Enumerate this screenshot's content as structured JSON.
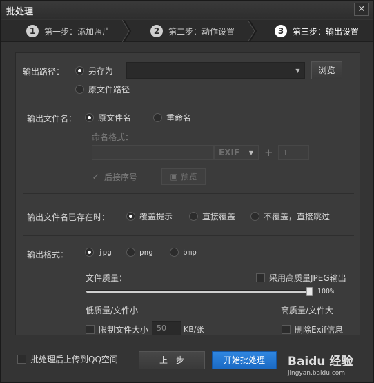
{
  "window": {
    "title": "批处理",
    "close_glyph": "✕"
  },
  "steps": [
    {
      "num": "1",
      "label": "第一步：添加照片",
      "active": false
    },
    {
      "num": "2",
      "label": "第二步：动作设置",
      "active": false
    },
    {
      "num": "3",
      "label": "第三步：输出设置",
      "active": true
    }
  ],
  "output_path": {
    "label": "输出路径：",
    "options": [
      "另存为",
      "原文件路径"
    ],
    "selected": "另存为",
    "path_value": "",
    "browse_label": "浏览"
  },
  "output_name": {
    "label": "输出文件名：",
    "options": [
      "原文件名",
      "重命名"
    ],
    "selected": "原文件名",
    "format_label": "命名格式：",
    "format_value": "",
    "exif_label": "EXIF",
    "plus": "+",
    "counter_value": "1",
    "append_seq_label": "后接序号",
    "preview_label": "预览"
  },
  "exists": {
    "label": "输出文件名已存在时：",
    "options": [
      "覆盖提示",
      "直接覆盖",
      "不覆盖，直接跳过"
    ],
    "selected": "覆盖提示"
  },
  "format": {
    "label": "输出格式：",
    "options": [
      "jpg",
      "png",
      "bmp"
    ],
    "selected": "jpg",
    "quality_label": "文件质量：",
    "hq_jpeg_label": "采用高质量JPEG输出",
    "quality_percent": "100%",
    "quality_value": 100,
    "low_label": "低质量/文件小",
    "high_label": "高质量/文件大",
    "limit_size_label": "限制文件大小",
    "limit_size_value": "50",
    "limit_unit": "KB/张",
    "remove_exif_label": "删除Exif信息"
  },
  "footer": {
    "upload_label": "批处理后上传到QQ空间",
    "prev_label": "上一步",
    "start_label": "开始批处理"
  },
  "watermark": {
    "brand": "Baidu 经验",
    "url": "jingyan.baidu.com"
  },
  "colors": {
    "accent": "#1b6ac4",
    "background": "#343434"
  }
}
